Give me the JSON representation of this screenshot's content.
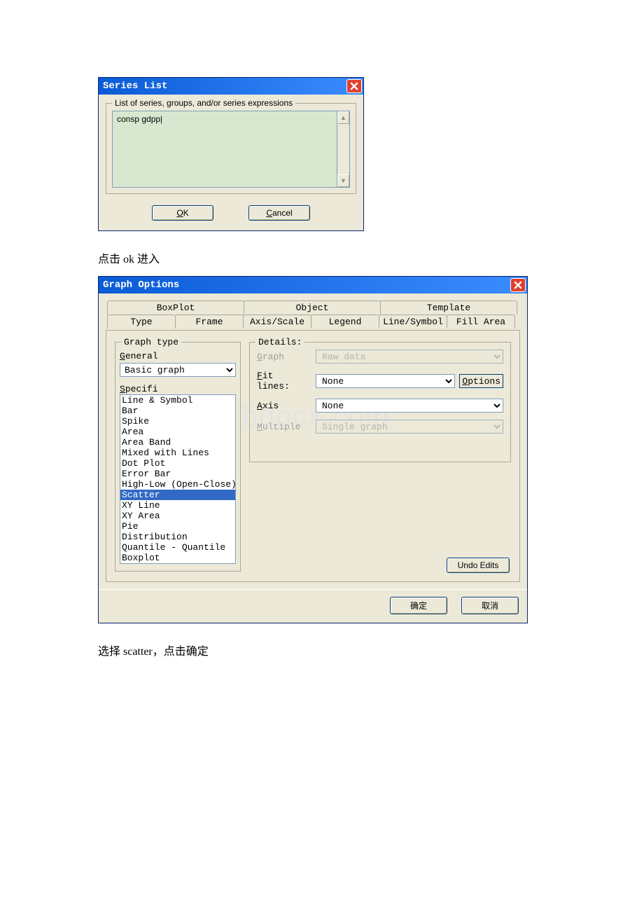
{
  "dlg1": {
    "title": "Series List",
    "legend": "List of series, groups, and/or series expressions",
    "input_value": "consp gdpp|",
    "ok": "OK",
    "cancel": "Cancel"
  },
  "caption1": "点击 ok 进入",
  "dlg2": {
    "title": "Graph Options",
    "tabs_back": [
      "BoxPlot",
      "Object",
      "Template"
    ],
    "tabs_front": [
      "Type",
      "Frame",
      "Axis/Scale",
      "Legend",
      "Line/Symbol",
      "Fill Area"
    ],
    "active_tab": "Type",
    "graphtype": {
      "legend": "Graph type",
      "general_label": "General",
      "general_select": "Basic graph",
      "specific_label": "Specifi",
      "items": [
        "Line & Symbol",
        "Bar",
        "Spike",
        "Area",
        "Area Band",
        "Mixed with Lines",
        "Dot Plot",
        "Error Bar",
        "High-Low (Open-Close)",
        "Scatter",
        "XY Line",
        "XY Area",
        "Pie",
        "Distribution",
        "Quantile - Quantile",
        "Boxplot"
      ],
      "selected": "Scatter"
    },
    "details": {
      "legend": "Details:",
      "graph_label": "Graph",
      "graph_value": "Raw data",
      "fit_label": "Fit lines:",
      "fit_value": "None",
      "options_btn": "Options",
      "axis_label": "Axis",
      "axis_value": "None",
      "mult_label": "Multiple",
      "mult_value": "Single graph"
    },
    "undo": "Undo Edits",
    "ok": "确定",
    "cancel": "取消"
  },
  "caption2": "选择 scatter，点击确定",
  "watermark": "www.bdocx.com"
}
